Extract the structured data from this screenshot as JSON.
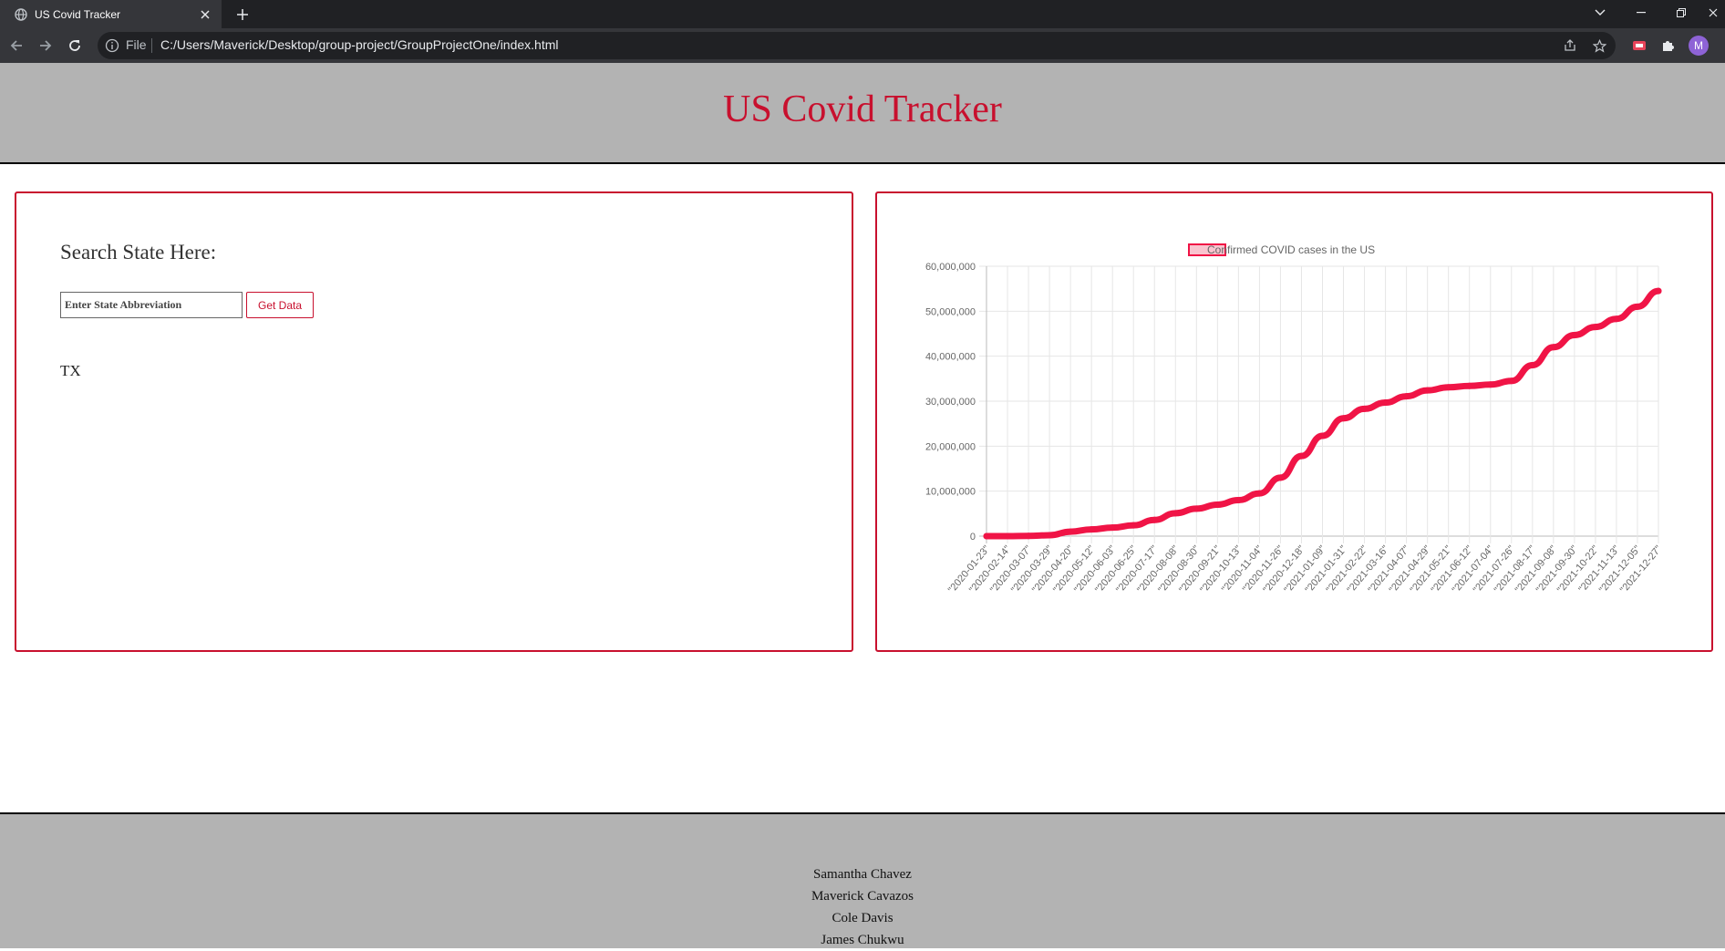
{
  "browser": {
    "tab_title": "US Covid Tracker",
    "scheme_label": "File",
    "url": "C:/Users/Maverick/Desktop/group-project/GroupProjectOne/index.html",
    "profile_initial": "M"
  },
  "header": {
    "title": "US Covid Tracker"
  },
  "search": {
    "label": "Search State Here:",
    "placeholder": "Enter State Abbreviation",
    "button_label": "Get Data",
    "result": "TX"
  },
  "chart_data": {
    "type": "line",
    "legend": "Confirmed COVID cases in the US",
    "legend_position": "top",
    "color": "#f01446",
    "grid": true,
    "ylim": [
      0,
      60000000
    ],
    "yticks": [
      "0",
      "10,000,000",
      "20,000,000",
      "30,000,000",
      "40,000,000",
      "50,000,000",
      "60,000,000"
    ],
    "xticks": [
      "\"2020-01-23\"",
      "\"2020-02-14\"",
      "\"2020-03-07\"",
      "\"2020-03-29\"",
      "\"2020-04-20\"",
      "\"2020-05-12\"",
      "\"2020-06-03\"",
      "\"2020-06-25\"",
      "\"2020-07-17\"",
      "\"2020-08-08\"",
      "\"2020-08-30\"",
      "\"2020-09-21\"",
      "\"2020-10-13\"",
      "\"2020-11-04\"",
      "\"2020-11-26\"",
      "\"2020-12-18\"",
      "\"2021-01-09\"",
      "\"2021-01-31\"",
      "\"2021-02-22\"",
      "\"2021-03-16\"",
      "\"2021-04-07\"",
      "\"2021-04-29\"",
      "\"2021-05-21\"",
      "\"2021-06-12\"",
      "\"2021-07-04\"",
      "\"2021-07-26\"",
      "\"2021-08-17\"",
      "\"2021-09-08\"",
      "\"2021-09-30\"",
      "\"2021-10-22\"",
      "\"2021-11-13\"",
      "\"2021-12-05\"",
      "\"2021-12-27\""
    ],
    "values": [
      0,
      0,
      50000,
      200000,
      1000000,
      1500000,
      1900000,
      2400000,
      3600000,
      5100000,
      6100000,
      7000000,
      8000000,
      9500000,
      13000000,
      17800000,
      22300000,
      26200000,
      28300000,
      29700000,
      31100000,
      32400000,
      33100000,
      33400000,
      33700000,
      34500000,
      38000000,
      42000000,
      44700000,
      46500000,
      48300000,
      51000000,
      54500000
    ]
  },
  "footer": {
    "credits": [
      "Samantha Chavez",
      "Maverick Cavazos",
      "Cole Davis",
      "James Chukwu"
    ]
  }
}
